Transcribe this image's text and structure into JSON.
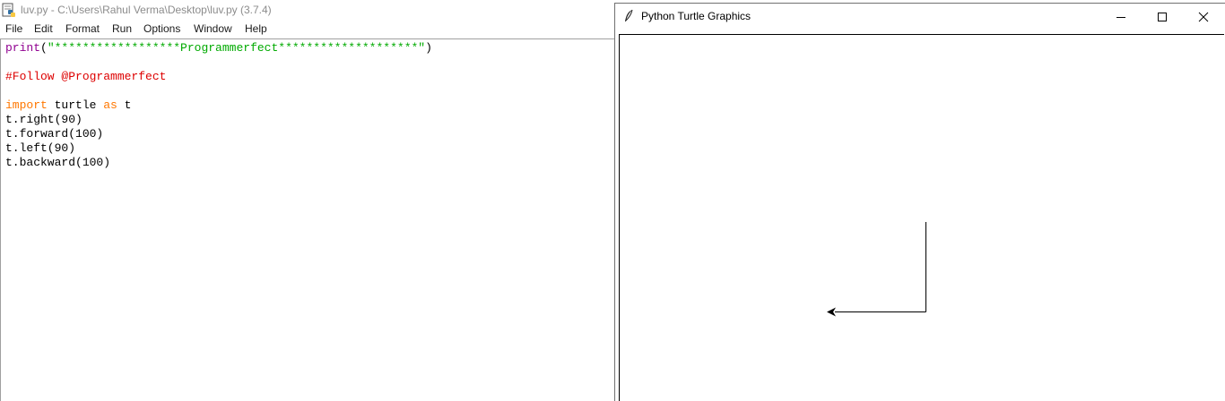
{
  "idle": {
    "title": "luv.py - C:\\Users\\Rahul Verma\\Desktop\\luv.py (3.7.4)",
    "menu": [
      "File",
      "Edit",
      "Format",
      "Run",
      "Options",
      "Window",
      "Help"
    ],
    "code": {
      "line1": {
        "fn": "print",
        "open": "(",
        "str": "\"******************Programmerfect********************\"",
        "close": ")"
      },
      "line2": "#Follow @Programmerfect",
      "line3": {
        "kw_import": "import",
        "module": " turtle ",
        "kw_as": "as",
        "alias": " t"
      },
      "line4": "t.right(90)",
      "line5": "t.forward(100)",
      "line6": "t.left(90)",
      "line7": "t.backward(100)"
    }
  },
  "turtle_window": {
    "title": "Python Turtle Graphics",
    "controls": {
      "minimize": "minimize-icon",
      "maximize": "maximize-icon",
      "close": "close-icon"
    },
    "pen_color": "#000000",
    "turtle_heading": "left"
  },
  "colors": {
    "builtin": "#900090",
    "string": "#00aa00",
    "comment": "#dd0000",
    "keyword": "#ff7700"
  }
}
